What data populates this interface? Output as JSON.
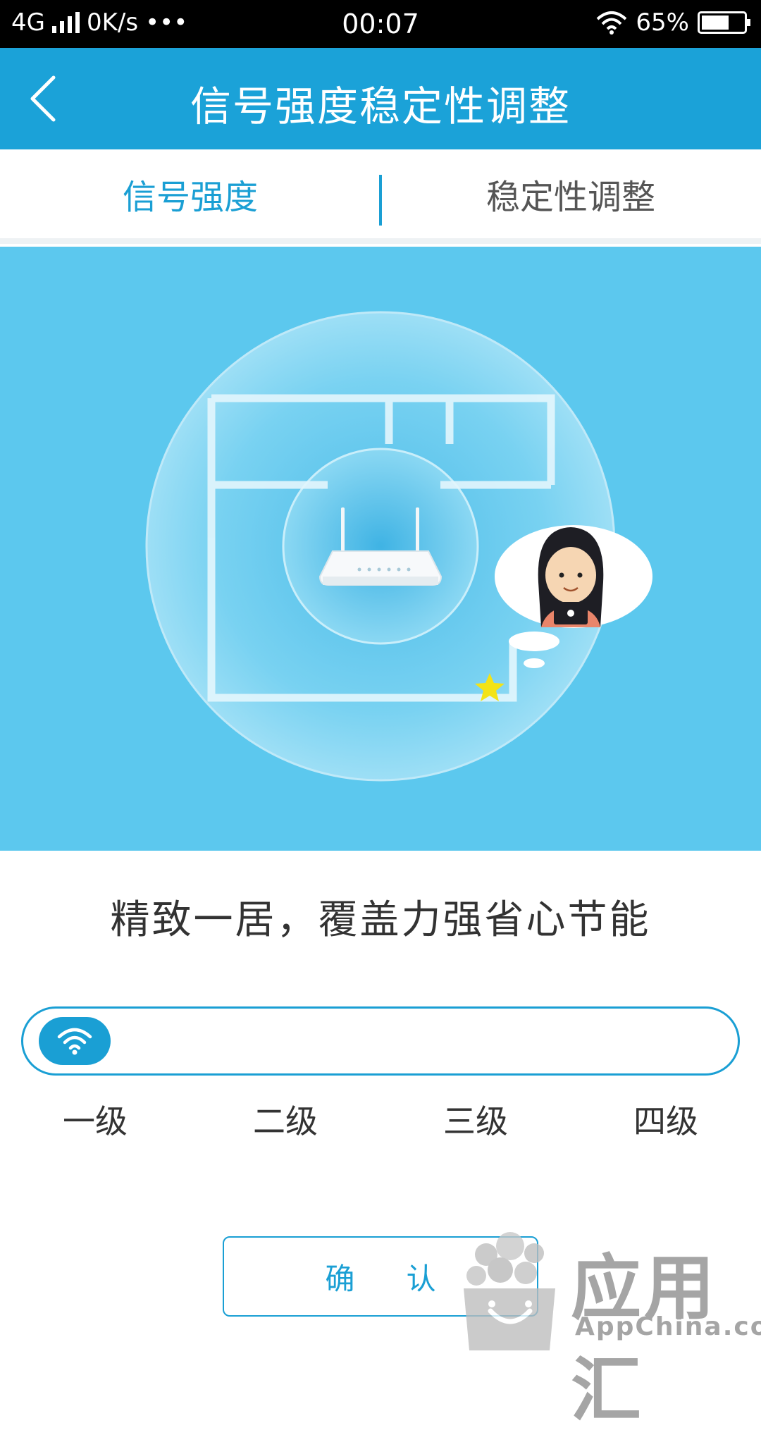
{
  "status_bar": {
    "network": "4G",
    "speed": "0K/s",
    "dots": "•••",
    "time": "00:07",
    "battery": "65%",
    "battery_level": 0.65
  },
  "app_bar": {
    "title": "信号强度稳定性调整"
  },
  "tabs": [
    {
      "label": "信号强度",
      "active": true
    },
    {
      "label": "稳定性调整",
      "active": false
    }
  ],
  "slogan": "精致一居，覆盖力强省心节能",
  "slider": {
    "levels": [
      "一级",
      "二级",
      "三级",
      "四级"
    ],
    "selected_index": 0
  },
  "confirm_label": "确 认",
  "watermark": {
    "cn": "应用汇",
    "en": "AppChina.com"
  },
  "colors": {
    "accent": "#1a9fd4",
    "app_bar": "#1ba2d8",
    "hero_bg": "#5cc8ee"
  }
}
